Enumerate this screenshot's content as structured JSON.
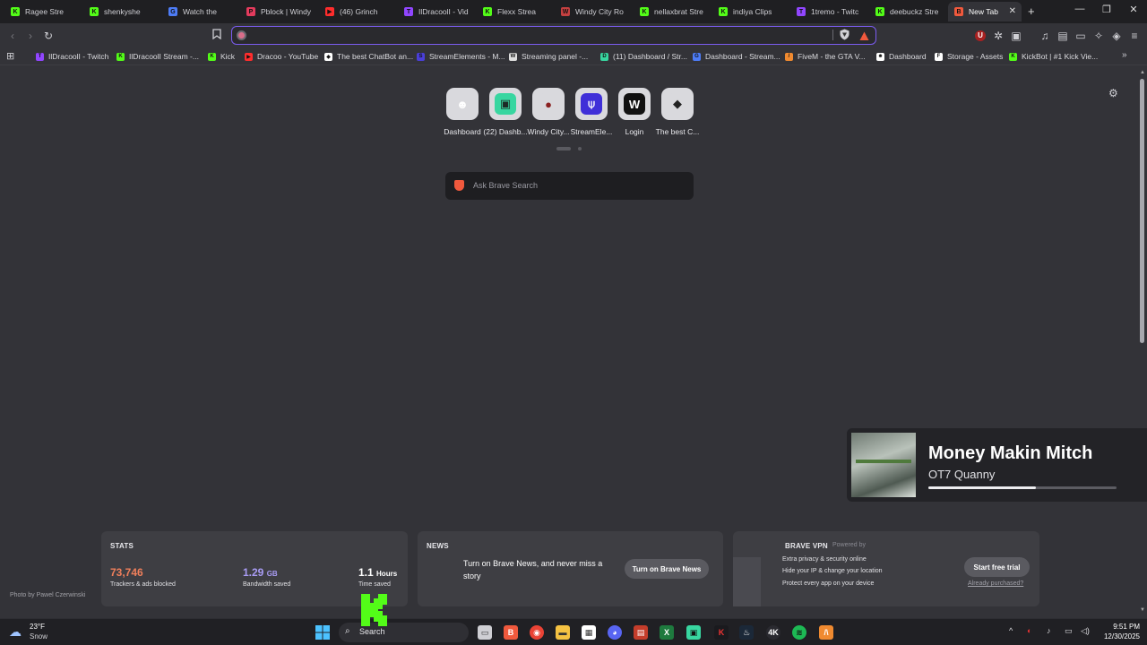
{
  "tabs": [
    {
      "title": "Ragee Stre",
      "color": "#53fc18",
      "glyph": "K"
    },
    {
      "title": "shenkyshe",
      "color": "#53fc18",
      "glyph": "K"
    },
    {
      "title": "Watch the",
      "color": "#4d7cf6",
      "glyph": "G"
    },
    {
      "title": "Pblock | Windy",
      "color": "#e33b5d",
      "glyph": "P"
    },
    {
      "title": "(46) Grinch",
      "color": "#ff2d2d",
      "glyph": "▶"
    },
    {
      "title": "IlDracoolI - Vid",
      "color": "#9146ff",
      "glyph": "T"
    },
    {
      "title": "Flexx Strea",
      "color": "#53fc18",
      "glyph": "K"
    },
    {
      "title": "Windy City Ro",
      "color": "#c44040",
      "glyph": "W"
    },
    {
      "title": "nellaxbrat Stre",
      "color": "#53fc18",
      "glyph": "K"
    },
    {
      "title": "indiya Clips",
      "color": "#53fc18",
      "glyph": "K"
    },
    {
      "title": "1tremo - Twitc",
      "color": "#9146ff",
      "glyph": "T"
    },
    {
      "title": "deebuckz Stre",
      "color": "#53fc18",
      "glyph": "K"
    },
    {
      "title": "New Tab",
      "color": "#f0593d",
      "glyph": "B"
    }
  ],
  "address_bar": {
    "value": "",
    "placeholder": ""
  },
  "bookmarks": [
    {
      "title": "IlDracoolI - Twitch",
      "color": "#9146ff",
      "glyph": "T"
    },
    {
      "title": "IlDracoolI Stream -...",
      "color": "#53fc18",
      "glyph": "K"
    },
    {
      "title": "Kick",
      "color": "#53fc18",
      "glyph": "K"
    },
    {
      "title": "Dracoo - YouTube",
      "color": "#ff2d2d",
      "glyph": "▶"
    },
    {
      "title": "The best ChatBot an...",
      "color": "#ffffff",
      "glyph": "◆"
    },
    {
      "title": "StreamElements - M...",
      "color": "#4a3fd8",
      "glyph": "S"
    },
    {
      "title": "Streaming panel -...",
      "color": "#dddddd",
      "glyph": "W"
    },
    {
      "title": "(11) Dashboard / Str...",
      "color": "#38d6a0",
      "glyph": "D"
    },
    {
      "title": "Dashboard - Stream...",
      "color": "#4d7cf6",
      "glyph": "G"
    },
    {
      "title": "FiveM - the GTA V...",
      "color": "#f08a30",
      "glyph": "/"
    },
    {
      "title": "Dashboard",
      "color": "#ffffff",
      "glyph": "☻"
    },
    {
      "title": "Storage - Assets",
      "color": "#ffffff",
      "glyph": "F"
    },
    {
      "title": "KickBot | #1 Kick Vie...",
      "color": "#53fc18",
      "glyph": "K"
    }
  ],
  "top_sites": [
    {
      "label": "Dashboard",
      "icon": "robot-icon",
      "bg": "#d9d9dd",
      "fg": "#ffffff",
      "glyph": "☻"
    },
    {
      "label": "(22) Dashb...",
      "icon": "dashboard-icon",
      "bg": "#38d6a0",
      "fg": "#1d2a26",
      "glyph": "▣"
    },
    {
      "label": "Windy City...",
      "icon": "windy-city-icon",
      "bg": "#d9d9dd",
      "fg": "#8a2020",
      "glyph": "●"
    },
    {
      "label": "StreamEle...",
      "icon": "streamelements-icon",
      "bg": "#3f2fd8",
      "fg": "#ffffff",
      "glyph": "⍦"
    },
    {
      "label": "Login",
      "icon": "login-icon",
      "bg": "#111111",
      "fg": "#ffffff",
      "glyph": "W"
    },
    {
      "label": "The best C...",
      "icon": "chatbot-icon",
      "bg": "#d9d9dd",
      "fg": "#222222",
      "glyph": "◆"
    }
  ],
  "search_placeholder": "Ask Brave Search",
  "media": {
    "title": "Money Makin Mitch",
    "artist": "OT7 Quanny",
    "progress": 0.57
  },
  "stats": {
    "heading": "STATS",
    "trackers_value": "73,746",
    "trackers_label": "Trackers & ads blocked",
    "bandwidth_value": "1.29",
    "bandwidth_unit": "GB",
    "bandwidth_label": "Bandwidth saved",
    "time_value": "1.1",
    "time_unit": "Hours",
    "time_label": "Time saved",
    "trackers_color": "#f07f5b",
    "bandwidth_color": "#a99cf5"
  },
  "news": {
    "heading": "NEWS",
    "text": "Turn on Brave News, and never miss a story",
    "button": "Turn on Brave News"
  },
  "vpn": {
    "heading": "BRAVE VPN",
    "powered": "Powered by",
    "features": [
      "Extra privacy & security online",
      "Hide your IP & change your location",
      "Protect every app on your device"
    ],
    "button": "Start free trial",
    "link": "Already purchased?"
  },
  "photo_credit": "Photo by Pawel Czerwinski",
  "taskbar": {
    "weather_temp": "23°F",
    "weather_cond": "Snow",
    "search_label": "Search",
    "time": "9:51 PM",
    "date": "12/30/2025"
  }
}
